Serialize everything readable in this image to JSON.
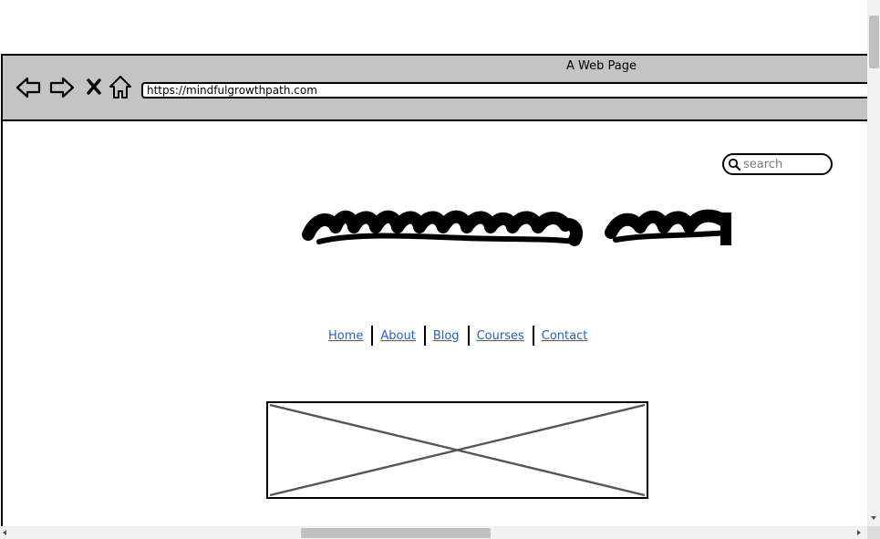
{
  "browser": {
    "window_title": "A Web Page",
    "url": "https://mindfulgrowthpath.com",
    "nav_icons": [
      "back-arrow-icon",
      "forward-arrow-icon",
      "close-x-icon",
      "home-icon"
    ]
  },
  "search": {
    "placeholder": "search",
    "icon": "search-icon"
  },
  "logo": {
    "icon": "scribbled-logo"
  },
  "nav": {
    "items": [
      {
        "label": "Home"
      },
      {
        "label": "About"
      },
      {
        "label": "Blog"
      },
      {
        "label": "Courses"
      },
      {
        "label": "Contact"
      }
    ],
    "link_color": "#2862b7"
  },
  "image_placeholder": {
    "icon": "image-placeholder-x"
  },
  "colors": {
    "chrome": "#c4c4c4",
    "border": "#000000",
    "placeholder_line": "#555555"
  }
}
